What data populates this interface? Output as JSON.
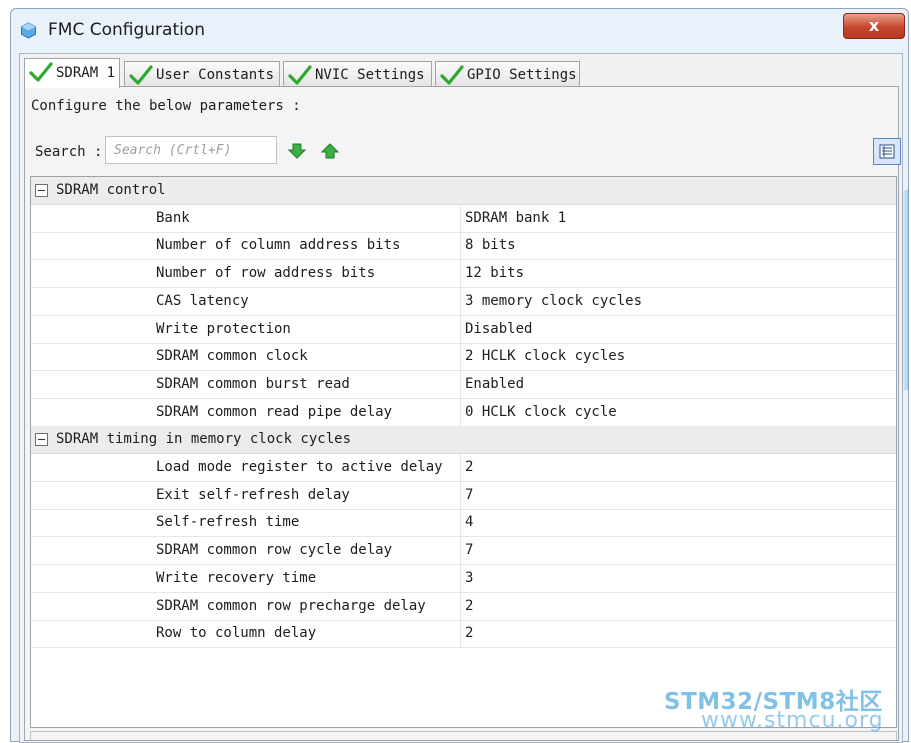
{
  "window": {
    "title": "FMC Configuration",
    "close_label": "x"
  },
  "tabs": [
    {
      "label": "SDRAM 1",
      "active": true
    },
    {
      "label": "User Constants",
      "active": false
    },
    {
      "label": "NVIC Settings",
      "active": false
    },
    {
      "label": "GPIO Settings",
      "active": false
    }
  ],
  "configure_text": "Configure the below parameters :",
  "search": {
    "label": "Search :",
    "placeholder": "Search (Crtl+F)",
    "value": ""
  },
  "icons": {
    "app": "cube-icon",
    "tab_check": "check-icon",
    "next": "arrow-down-icon",
    "prev": "arrow-up-icon",
    "view": "list-view-icon"
  },
  "colors": {
    "accent": "#5b86c6",
    "check": "#2fa82f",
    "arrow": "#3cb043",
    "close": "#c6452c",
    "watermark": "#3fa0d8"
  },
  "groups": [
    {
      "title": "SDRAM control",
      "expanded": true,
      "params": [
        {
          "name": "Bank",
          "value": "SDRAM bank 1"
        },
        {
          "name": "Number of column address bits",
          "value": "8 bits"
        },
        {
          "name": "Number of row address bits",
          "value": "12 bits"
        },
        {
          "name": "CAS latency",
          "value": "3 memory clock cycles"
        },
        {
          "name": "Write protection",
          "value": "Disabled"
        },
        {
          "name": "SDRAM common clock",
          "value": "2 HCLK clock cycles"
        },
        {
          "name": "SDRAM common burst read",
          "value": "Enabled"
        },
        {
          "name": "SDRAM common read pipe delay",
          "value": "0 HCLK clock cycle"
        }
      ]
    },
    {
      "title": "SDRAM timing in memory clock cycles",
      "expanded": true,
      "params": [
        {
          "name": "Load mode register to active delay",
          "value": "2"
        },
        {
          "name": "Exit self-refresh delay",
          "value": "7"
        },
        {
          "name": "Self-refresh time",
          "value": "4"
        },
        {
          "name": "SDRAM common row cycle delay",
          "value": "7"
        },
        {
          "name": "Write recovery time",
          "value": "3"
        },
        {
          "name": "SDRAM common row precharge delay",
          "value": "2"
        },
        {
          "name": "Row to column delay",
          "value": "2"
        }
      ]
    }
  ],
  "watermark": {
    "brand": "STM32/STM8社区",
    "url": "www.stmcu.org"
  }
}
